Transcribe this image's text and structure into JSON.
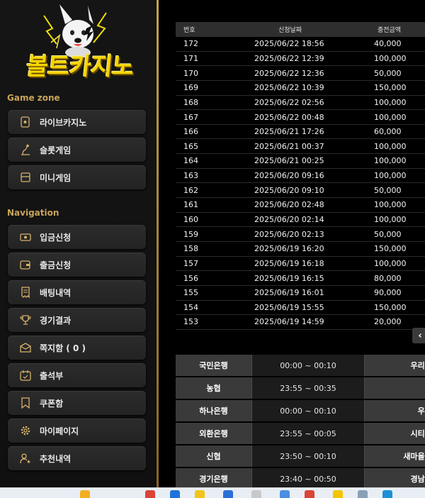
{
  "brand": {
    "logo_text": "볼트카지노"
  },
  "sidebar": {
    "game_zone_title": "Game zone",
    "game_items": [
      {
        "label": "라이브카지노",
        "icon": "card-icon"
      },
      {
        "label": "슬롯게임",
        "icon": "slot-lever-icon"
      },
      {
        "label": "미니게임",
        "icon": "mini-game-icon"
      }
    ],
    "navigation_title": "Navigation",
    "nav_items": [
      {
        "label": "입금신청",
        "icon": "money-icon"
      },
      {
        "label": "출금신청",
        "icon": "wallet-icon"
      },
      {
        "label": "배팅내역",
        "icon": "receipt-icon"
      },
      {
        "label": "경기결과",
        "icon": "trophy-icon"
      },
      {
        "label": "쪽지함 ( 0 )",
        "icon": "envelope-icon"
      },
      {
        "label": "출석부",
        "icon": "calendar-icon"
      },
      {
        "label": "쿠폰함",
        "icon": "coupon-icon"
      },
      {
        "label": "마이페이지",
        "icon": "gear-icon"
      },
      {
        "label": "추천내역",
        "icon": "user-star-icon"
      }
    ]
  },
  "deposits": {
    "headers": [
      "번호",
      "신청날짜",
      "충전금액"
    ],
    "rows": [
      [
        "172",
        "2025/06/22 18:56",
        "40,000"
      ],
      [
        "171",
        "2025/06/22 12:39",
        "100,000"
      ],
      [
        "170",
        "2025/06/22 12:36",
        "50,000"
      ],
      [
        "169",
        "2025/06/22 10:39",
        "150,000"
      ],
      [
        "168",
        "2025/06/22 02:56",
        "100,000"
      ],
      [
        "167",
        "2025/06/22 00:48",
        "100,000"
      ],
      [
        "166",
        "2025/06/21 17:26",
        "60,000"
      ],
      [
        "165",
        "2025/06/21 00:37",
        "100,000"
      ],
      [
        "164",
        "2025/06/21 00:25",
        "100,000"
      ],
      [
        "163",
        "2025/06/20 09:16",
        "100,000"
      ],
      [
        "162",
        "2025/06/20 09:10",
        "50,000"
      ],
      [
        "161",
        "2025/06/20 02:48",
        "100,000"
      ],
      [
        "160",
        "2025/06/20 02:14",
        "100,000"
      ],
      [
        "159",
        "2025/06/20 02:13",
        "50,000"
      ],
      [
        "158",
        "2025/06/19 16:20",
        "150,000"
      ],
      [
        "157",
        "2025/06/19 16:18",
        "100,000"
      ],
      [
        "156",
        "2025/06/19 16:15",
        "80,000"
      ],
      [
        "155",
        "2025/06/19 16:01",
        "90,000"
      ],
      [
        "154",
        "2025/06/19 15:55",
        "150,000"
      ],
      [
        "153",
        "2025/06/19 14:59",
        "20,000"
      ]
    ],
    "prev_label": "‹"
  },
  "bank_schedule": [
    [
      "국민은행",
      "00:00 ~ 00:10",
      "우리은행"
    ],
    [
      "농협",
      "23:55 ~ 00:35",
      "축협"
    ],
    [
      "하나은행",
      "00:00 ~ 00:10",
      "우체국"
    ],
    [
      "외환은행",
      "23:55 ~ 00:05",
      "시티은행"
    ],
    [
      "신협",
      "23:50 ~ 00:10",
      "새마을금고"
    ],
    [
      "경기은행",
      "23:40 ~ 00:50",
      "경남은행"
    ]
  ],
  "colors": {
    "accent_gold": "#c9a45a",
    "logo_yellow": "#f5d400"
  }
}
